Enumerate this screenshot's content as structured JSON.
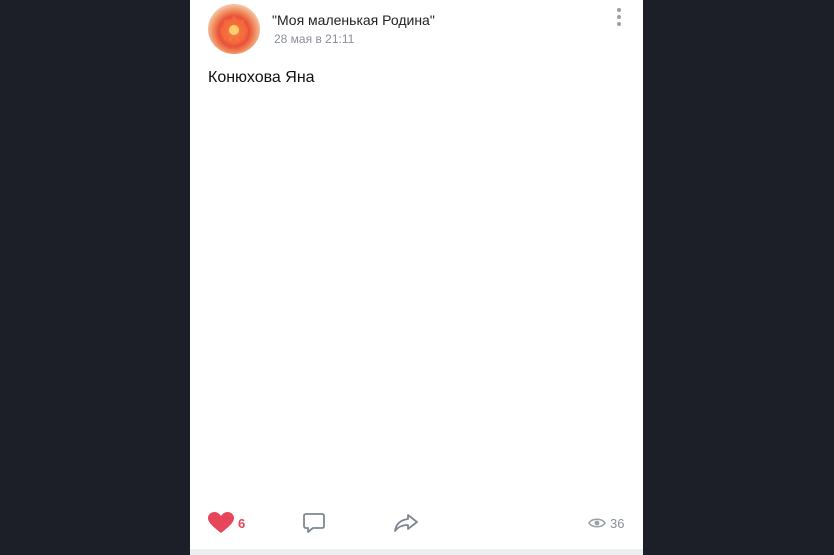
{
  "post": {
    "group_name": "\"Моя маленькая Родина\"",
    "date": "28 мая в 21:11",
    "text": "Конюхова Яна"
  },
  "photos": [
    {
      "name": "photo-frosty-trees"
    },
    {
      "name": "photo-frosted-branches"
    },
    {
      "name": "photo-winter-sunset-field"
    },
    {
      "name": "photo-snowflakes-closeup"
    },
    {
      "name": "photo-pink-sky-poles"
    },
    {
      "name": "photo-sunset-window"
    },
    {
      "name": "photo-green-clover"
    },
    {
      "name": "photo-dry-buds-branch"
    },
    {
      "name": "photo-green-moss"
    }
  ],
  "footer": {
    "likes": "6",
    "views": "36"
  },
  "icons": {
    "like": "heart-icon",
    "comment": "comment-icon",
    "share": "share-icon",
    "views": "eye-icon",
    "menu": "more-vertical-icon"
  },
  "colors": {
    "like_accent": "#e6455a",
    "muted_text": "#8a8f99",
    "background": "#1b1d24"
  }
}
